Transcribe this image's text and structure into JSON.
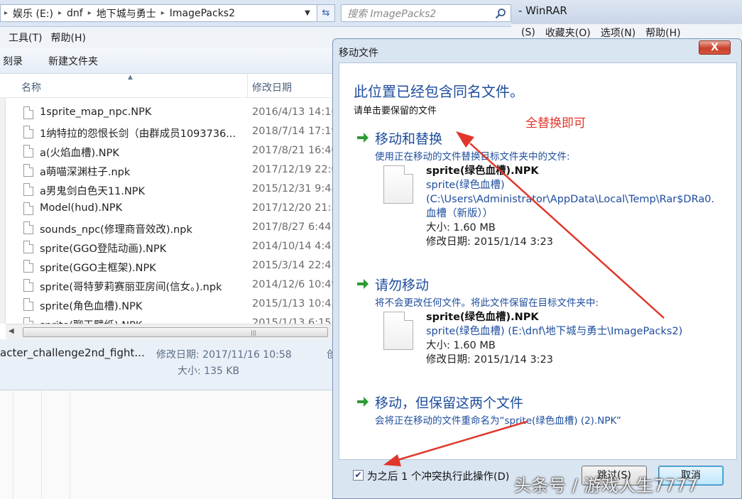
{
  "explorer": {
    "breadcrumb": [
      "娱乐 (E:)",
      "dnf",
      "地下城与勇士",
      "ImagePacks2"
    ],
    "search_placeholder": "搜索 ImagePacks2",
    "menu": [
      "工具(T)",
      "帮助(H)"
    ],
    "toolbar": [
      "刻录",
      "新建文件夹"
    ],
    "columns": {
      "name": "名称",
      "date": "修改日期"
    },
    "files": [
      {
        "name": "1sprite_map_npc.NPK",
        "date": "2016/4/13 14:16"
      },
      {
        "name": "1纳特拉的怨恨长剑（由群成员1093736...",
        "date": "2018/7/14 17:19"
      },
      {
        "name": "a(火焰血槽).NPK",
        "date": "2017/8/21 16:40"
      },
      {
        "name": "a萌喵深渊柱子.npk",
        "date": "2017/12/19 22:0"
      },
      {
        "name": "a男鬼剑白色天11.NPK",
        "date": "2015/12/31 9:48"
      },
      {
        "name": "Model(hud).NPK",
        "date": "2017/12/20 21:5"
      },
      {
        "name": "sounds_npc(修理商音效改).npk",
        "date": "2017/8/27 6:44"
      },
      {
        "name": "sprite(GGO登陆动画).NPK",
        "date": "2014/10/14 4:47"
      },
      {
        "name": "sprite(GGO主框架).NPK",
        "date": "2015/3/14 22:47"
      },
      {
        "name": "sprite(哥特萝莉赛丽亚房间(信女。).npk",
        "date": "2014/12/6 10:49"
      },
      {
        "name": "sprite(角色血槽).NPK",
        "date": "2015/1/13 10:43"
      },
      {
        "name": "sprite(聊天壁纸).NPK",
        "date": "2015/1/13 6:15"
      }
    ],
    "details": {
      "name": "acter_challenge2nd_fight...",
      "modified": "修改日期: 2017/11/16 10:58",
      "size": "大小: 135 KB",
      "extra": "创"
    }
  },
  "winrar": {
    "title": "- WinRAR",
    "menu": [
      "(S)",
      "收藏夹(O)",
      "选项(N)",
      "帮助(H)"
    ]
  },
  "dialog": {
    "title": "移动文件",
    "close": "X",
    "main_instruction": "此位置已经包含同名文件。",
    "sub_instruction": "请单击要保留的文件",
    "annotation": "全替换即可",
    "options": [
      {
        "title": "移动和替换",
        "desc": "使用正在移动的文件替换目标文件夹中的文件:",
        "file_name": "sprite(绿色血槽).NPK",
        "path_lines": [
          "sprite(绿色血槽)",
          "(C:\\Users\\Administrator\\AppData\\Local\\Temp\\Rar$DRa0.",
          "血槽（新版））"
        ],
        "size": "大小: 1.60 MB",
        "modified": "修改日期: 2015/1/14 3:23"
      },
      {
        "title": "请勿移动",
        "desc": "将不会更改任何文件。将此文件保留在目标文件夹中:",
        "file_name": "sprite(绿色血槽).NPK",
        "path_lines": [
          "sprite(绿色血槽) (E:\\dnf\\地下城与勇士\\ImagePacks2)"
        ],
        "size": "大小: 1.60 MB",
        "modified": "修改日期: 2015/1/14 3:23"
      },
      {
        "title": "移动，但保留这两个文件",
        "desc": "会将正在移动的文件重命名为“sprite(绿色血槽) (2).NPK”"
      }
    ],
    "checkbox_label": "为之后 1 个冲突执行此操作(D)",
    "checkbox_checked": true,
    "skip_button": "跳过(S)",
    "cancel_button": "取消"
  },
  "watermark": "头条号 / 游戏人生7777",
  "colors": {
    "link_blue": "#1e4d9c",
    "annotation_red": "#e0372b",
    "dialog_frame": "#dae5f2"
  }
}
